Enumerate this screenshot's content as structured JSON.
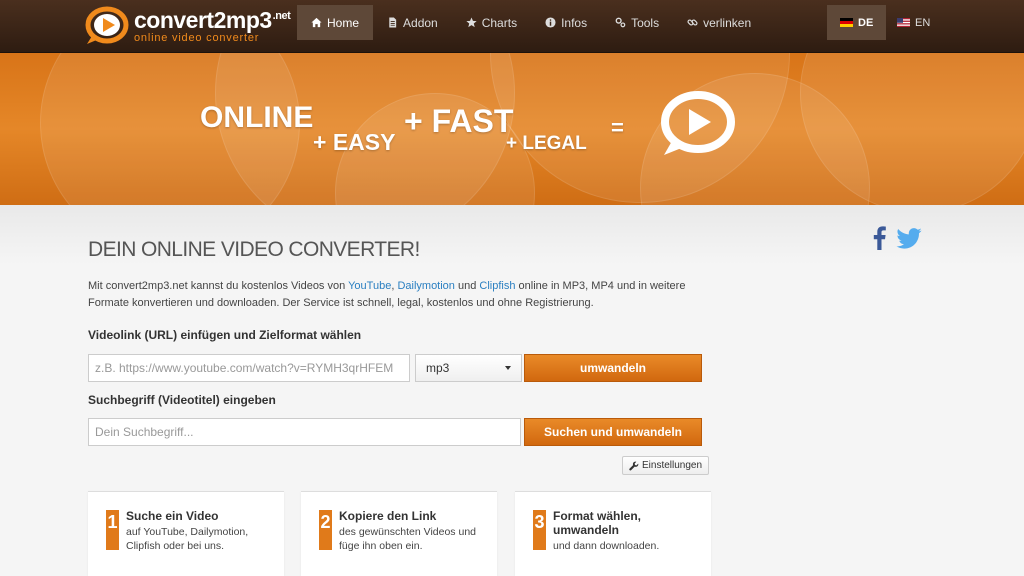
{
  "brand": {
    "name": "convert2mp3",
    "tld": ".net",
    "tagline": "online video converter"
  },
  "nav": {
    "items": [
      {
        "label": "Home",
        "icon": "home-icon"
      },
      {
        "label": "Addon",
        "icon": "document-icon"
      },
      {
        "label": "Charts",
        "icon": "star-icon"
      },
      {
        "label": "Infos",
        "icon": "info-icon"
      },
      {
        "label": "Tools",
        "icon": "tools-icon"
      },
      {
        "label": "verlinken",
        "icon": "link-icon"
      }
    ],
    "active": "Home"
  },
  "languages": [
    {
      "code": "DE",
      "flag": "german-flag-icon",
      "active": true
    },
    {
      "code": "EN",
      "flag": "us-flag-icon",
      "active": false
    }
  ],
  "hero": {
    "word1": "ONLINE",
    "word2": "+ EASY",
    "word3": "+ FAST",
    "word4": "+ LEGAL",
    "equals": "="
  },
  "main": {
    "title": "DEIN ONLINE VIDEO CONVERTER!",
    "intro": {
      "part1": "Mit convert2mp3.net kannst du kostenlos Videos von ",
      "link1": "YouTube",
      "sep1": ", ",
      "link2": "Dailymotion",
      "sep2": " und ",
      "link3": "Clipfish",
      "part2": " online in MP3, MP4 und in weitere Formate konvertieren und downloaden. Der Service ist schnell, legal, kostenlos und ohne Registrierung."
    },
    "url_label": "Videolink (URL) einfügen und Zielformat wählen",
    "url_placeholder": "z.B. https://www.youtube.com/watch?v=RYMH3qrHFEM",
    "format_selected": "mp3",
    "convert_label": "umwandeln",
    "search_label": "Suchbegriff (Videotitel) eingeben",
    "search_placeholder": "Dein Suchbegriff...",
    "search_button": "Suchen und umwandeln",
    "settings_label": "Einstellungen"
  },
  "steps": [
    {
      "num": "1",
      "title": "Suche ein Video",
      "desc": "auf YouTube, Dailymotion, Clipfish oder bei uns."
    },
    {
      "num": "2",
      "title": "Kopiere den Link",
      "desc": "des gewünschten Videos und füge ihn oben ein."
    },
    {
      "num": "3",
      "title": "Format wählen, umwandeln",
      "desc": "und dann downloaden."
    }
  ],
  "colors": {
    "accent": "#e07a1a",
    "navbar": "#3b2618",
    "link": "#2a7fc1"
  }
}
